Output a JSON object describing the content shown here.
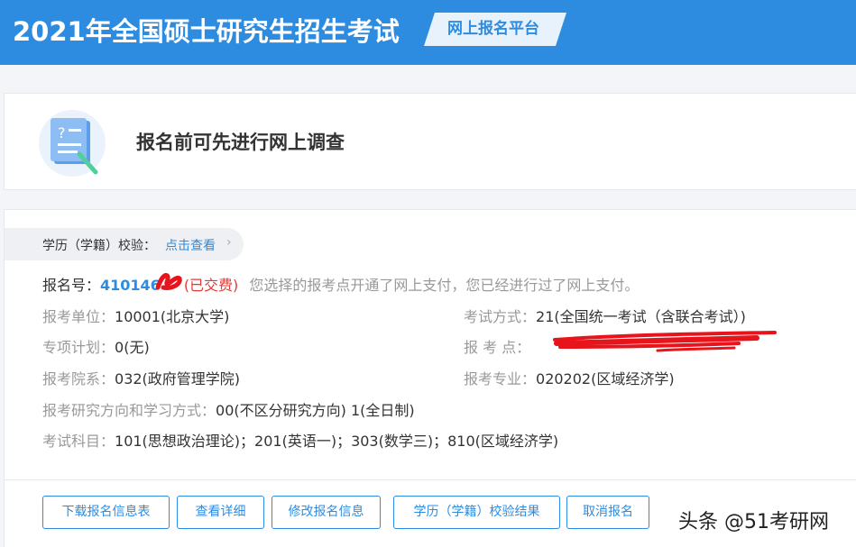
{
  "header": {
    "title": "2021年全国硕士研究生招生考试",
    "badge": "网上报名平台"
  },
  "survey": {
    "icon": "document-question-icon",
    "text": "报名前可先进行网上调查"
  },
  "verification": {
    "label": "学历（学籍）校验：",
    "link": "点击查看",
    "chevron": "›"
  },
  "registration": {
    "label": "报名号：",
    "number": "410146",
    "status": "(已交费)",
    "note": "您选择的报考点开通了网上支付，您已经进行过了网上支付。"
  },
  "fields": {
    "unit_label": "报考单位：",
    "unit_value": "10001(北京大学)",
    "exam_method_label": "考试方式：",
    "exam_method_value": "21(全国统一考试（含联合考试）)",
    "special_plan_label": "专项计划：",
    "special_plan_value": "0(无)",
    "exam_site_label": "报 考 点：",
    "dept_label": "报考院系：",
    "dept_value": "032(政府管理学院)",
    "major_label": "报考专业：",
    "major_value": "020202(区域经济学)",
    "direction_label": "报考研究方向和学习方式：",
    "direction_value": "00(不区分研究方向) 1(全日制)",
    "subjects_label": "考试科目：",
    "subjects_value": "101(思想政治理论)；201(英语一)；303(数学三)；810(区域经济学)"
  },
  "buttons": {
    "download": "下载报名信息表",
    "details": "查看详细",
    "modify": "修改报名信息",
    "verify_result": "学历（学籍）校验结果",
    "cancel": "取消报名"
  },
  "watermark": "头条 @51考研网",
  "colors": {
    "primary": "#2d8ce0",
    "paid": "#e53935",
    "redaction": "#e8141c"
  }
}
